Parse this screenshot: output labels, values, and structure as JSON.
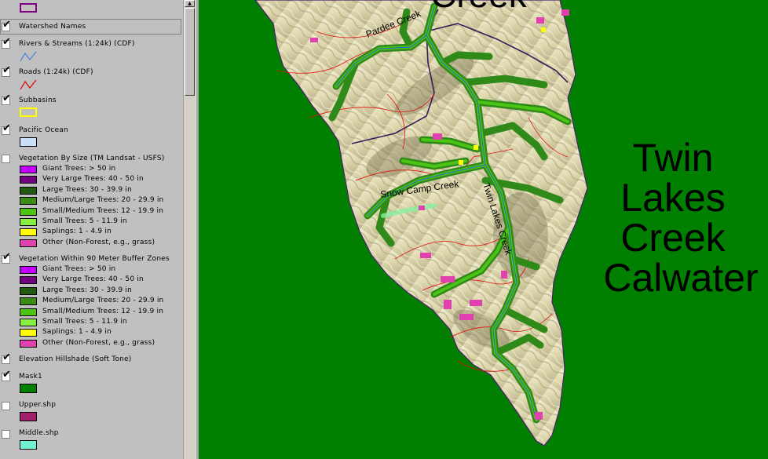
{
  "legend": {
    "top_symbol_color": "#800080",
    "layers": {
      "watershed_names": {
        "name": "Watershed Names",
        "checked": true
      },
      "rivers": {
        "name": "Rivers & Streams (1:24k) (CDF)",
        "checked": true,
        "line_color": "#4a7fd8"
      },
      "roads": {
        "name": "Roads (1:24k) (CDF)",
        "checked": true,
        "line_color": "#e00000"
      },
      "subbasins": {
        "name": "Subbasins",
        "checked": true,
        "outline_color": "#ffff00"
      },
      "pacific_ocean": {
        "name": "Pacific Ocean",
        "checked": true,
        "fill_color": "#c8e0f8"
      },
      "veg_by_size": {
        "name": "Vegetation By Size (TM Landsat - USFS)",
        "checked": false
      },
      "veg_buffer": {
        "name": "Vegetation Within 90 Meter Buffer Zones",
        "checked": true
      },
      "hillshade": {
        "name": "Elevation Hillshade (Soft Tone)",
        "checked": true
      },
      "mask1": {
        "name": "Mask1",
        "checked": true,
        "fill_color": "#007f00"
      },
      "upper": {
        "name": "Upper.shp",
        "checked": false,
        "fill_color": "#a0206a"
      },
      "middle": {
        "name": "Middle.shp",
        "checked": false,
        "fill_color": "#6ff2d2"
      }
    },
    "veg_classes": [
      {
        "label": "Giant Trees: > 50 in",
        "color": "#c000ff"
      },
      {
        "label": "Very Large Trees: 40 - 50 in",
        "color": "#700080"
      },
      {
        "label": "Large Trees: 30 - 39.9 in",
        "color": "#1f5a10"
      },
      {
        "label": "Medium/Large Trees: 20 - 29.9 in",
        "color": "#3a8a14"
      },
      {
        "label": "Small/Medium Trees: 12 - 19.9 in",
        "color": "#4cc414"
      },
      {
        "label": "Small Trees: 5 - 11.9 in",
        "color": "#88f040"
      },
      {
        "label": "Saplings: 1 - 4.9 in",
        "color": "#ffff00"
      },
      {
        "label": "Other (Non-Forest, e.g., grass)",
        "color": "#e040b0"
      }
    ],
    "check_mark": "✔"
  },
  "map": {
    "background_color": "#007f00",
    "watershed_label_lines": [
      "Twin",
      "Lakes",
      "Creek",
      "Calwater"
    ],
    "top_partial_label": "Creek",
    "creek_labels": {
      "pardee": "Pardee Creek",
      "snow_camp": "Snow Camp Creek",
      "twin_lakes": "Twin Lakes Creek"
    }
  }
}
